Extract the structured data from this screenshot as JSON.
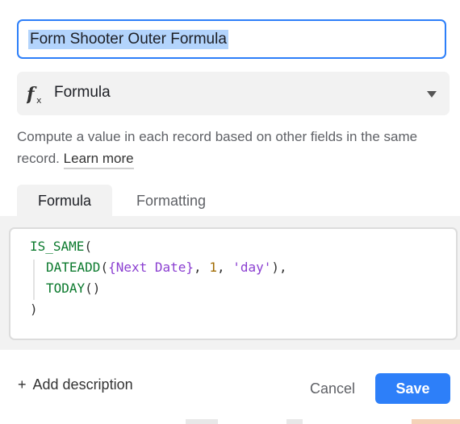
{
  "field_name": {
    "value": "Form Shooter Outer Formula"
  },
  "field_type": {
    "label": "Formula",
    "icon": "formula-fx-icon"
  },
  "description": {
    "text": "Compute a value in each record based on other fields in the same record.",
    "learn_more": "Learn more"
  },
  "tabs": [
    {
      "label": "Formula",
      "active": true
    },
    {
      "label": "Formatting",
      "active": false
    }
  ],
  "formula": {
    "line1_fn": "IS_SAME",
    "line1_open": "(",
    "line2_fn": "DATEADD",
    "line2_open": "(",
    "line2_field": "{Next Date}",
    "line2_sep1": ", ",
    "line2_num": "1",
    "line2_sep2": ", ",
    "line2_str": "'day'",
    "line2_close": "),",
    "line3_fn": "TODAY",
    "line3_parens": "()",
    "line4_close": ")"
  },
  "footer": {
    "add_description": "Add description",
    "cancel": "Cancel",
    "save": "Save"
  },
  "colors": {
    "accent": "#2d7ff9",
    "selection": "#b3d4fc"
  }
}
